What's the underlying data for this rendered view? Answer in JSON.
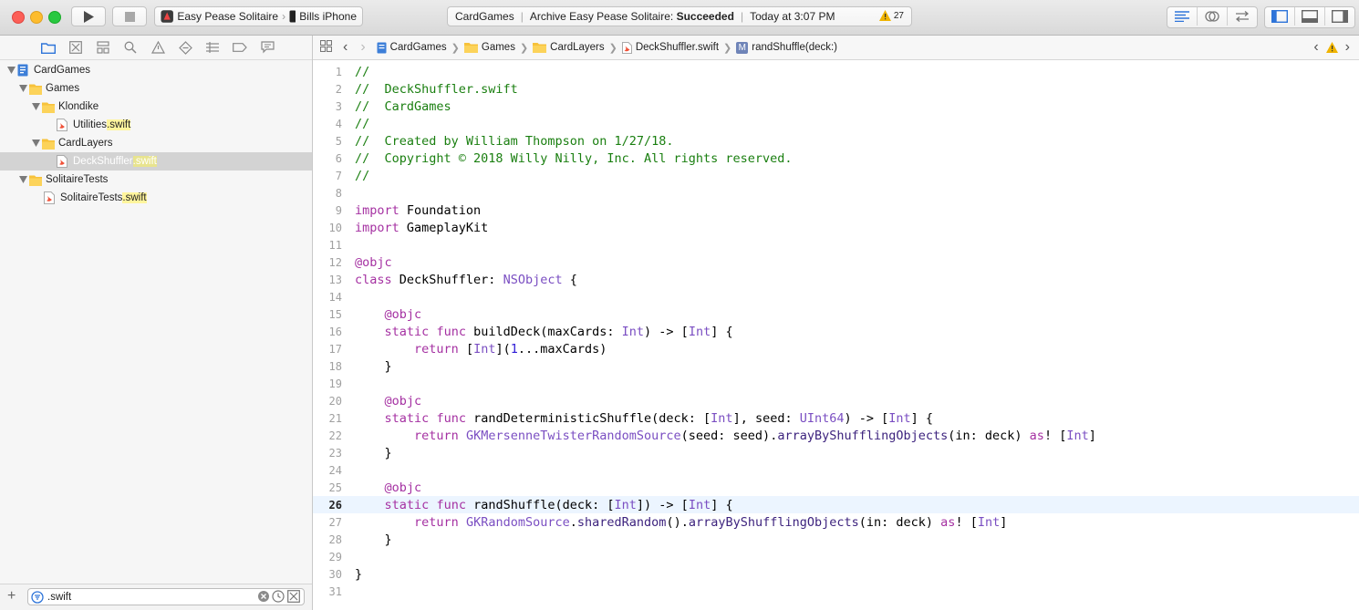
{
  "toolbar": {
    "scheme": "Easy Pease Solitaire",
    "device": "Bills iPhone",
    "activity_project": "CardGames",
    "activity_prefix": "Archive Easy Pease Solitaire:",
    "activity_status": "Succeeded",
    "activity_time": "Today at 3:07 PM",
    "warning_count": "27"
  },
  "navigator": {
    "tree": [
      {
        "label": "CardGames",
        "suffix": ""
      },
      {
        "label": "Games",
        "suffix": ""
      },
      {
        "label": "Klondike",
        "suffix": ""
      },
      {
        "label": "Utilities",
        "suffix": ".swift"
      },
      {
        "label": "CardLayers",
        "suffix": ""
      },
      {
        "label": "DeckShuffler",
        "suffix": ".swift"
      },
      {
        "label": "SolitaireTests",
        "suffix": ""
      },
      {
        "label": "SolitaireTests",
        "suffix": ".swift"
      }
    ],
    "filter_value": ".swift"
  },
  "jumpbar": {
    "crumbs": [
      "CardGames",
      "Games",
      "CardLayers",
      "DeckShuffler.swift",
      "randShuffle(deck:)"
    ],
    "method_badge": "M"
  },
  "editor": {
    "current_line": "26",
    "line_numbers": [
      "1",
      "2",
      "3",
      "4",
      "5",
      "6",
      "7",
      "8",
      "9",
      "10",
      "11",
      "12",
      "13",
      "14",
      "15",
      "16",
      "17",
      "18",
      "19",
      "20",
      "21",
      "22",
      "23",
      "24",
      "25",
      "26",
      "27",
      "28",
      "29",
      "30",
      "31"
    ],
    "lines": [
      "//",
      "//  DeckShuffler.swift",
      "//  CardGames",
      "//",
      "//  Created by William Thompson on 1/27/18.",
      "//  Copyright © 2018 Willy Nilly, Inc. All rights reserved.",
      "//",
      "",
      "import Foundation",
      "import GameplayKit",
      "",
      "@objc",
      "class DeckShuffler: NSObject {",
      "",
      "    @objc",
      "    static func buildDeck(maxCards: Int) -> [Int] {",
      "        return [Int](1...maxCards)",
      "    }",
      "",
      "    @objc",
      "    static func randDeterministicShuffle(deck: [Int], seed: UInt64) -> [Int] {",
      "        return GKMersenneTwisterRandomSource(seed: seed).arrayByShufflingObjects(in: deck) as! [Int]",
      "    }",
      "",
      "    @objc",
      "    static func randShuffle(deck: [Int]) -> [Int] {",
      "        return GKRandomSource.sharedRandom().arrayByShufflingObjects(in: deck) as! [Int]",
      "    }",
      "",
      "}",
      ""
    ]
  }
}
